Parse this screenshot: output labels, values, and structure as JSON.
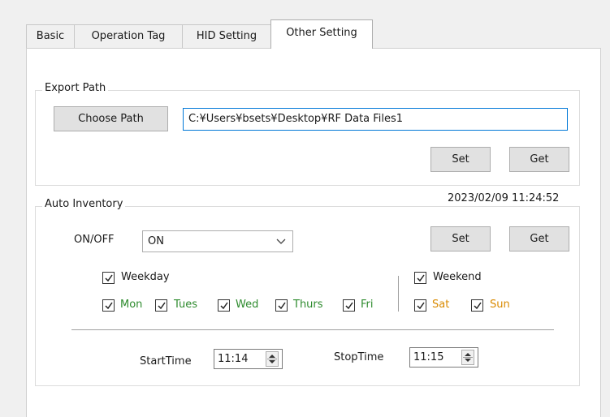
{
  "tabs": [
    {
      "label": "Basic"
    },
    {
      "label": "Operation Tag"
    },
    {
      "label": "HID Setting"
    },
    {
      "label": "Other Setting"
    }
  ],
  "export_path": {
    "legend": "Export Path",
    "choose_label": "Choose Path",
    "path_value": "C:¥Users¥bsets¥Desktop¥RF Data Files1",
    "set_label": "Set",
    "get_label": "Get"
  },
  "timestamp": "2023/02/09 11:24:52",
  "auto_inventory": {
    "legend": "Auto Inventory",
    "onoff_label": "ON/OFF",
    "onoff_value": "ON",
    "set_label": "Set",
    "get_label": "Get",
    "weekday_label": "Weekday",
    "weekend_label": "Weekend",
    "days": {
      "mon": "Mon",
      "tues": "Tues",
      "wed": "Wed",
      "thurs": "Thurs",
      "fri": "Fri",
      "sat": "Sat",
      "sun": "Sun"
    },
    "start_label": "StartTime",
    "start_value": "11:14",
    "stop_label": "StopTime",
    "stop_value": "11:15"
  },
  "colors": {
    "weekday_days": "#2e8b2e",
    "weekend_days": "#d98a00",
    "input_focus_border": "#0078d7"
  }
}
